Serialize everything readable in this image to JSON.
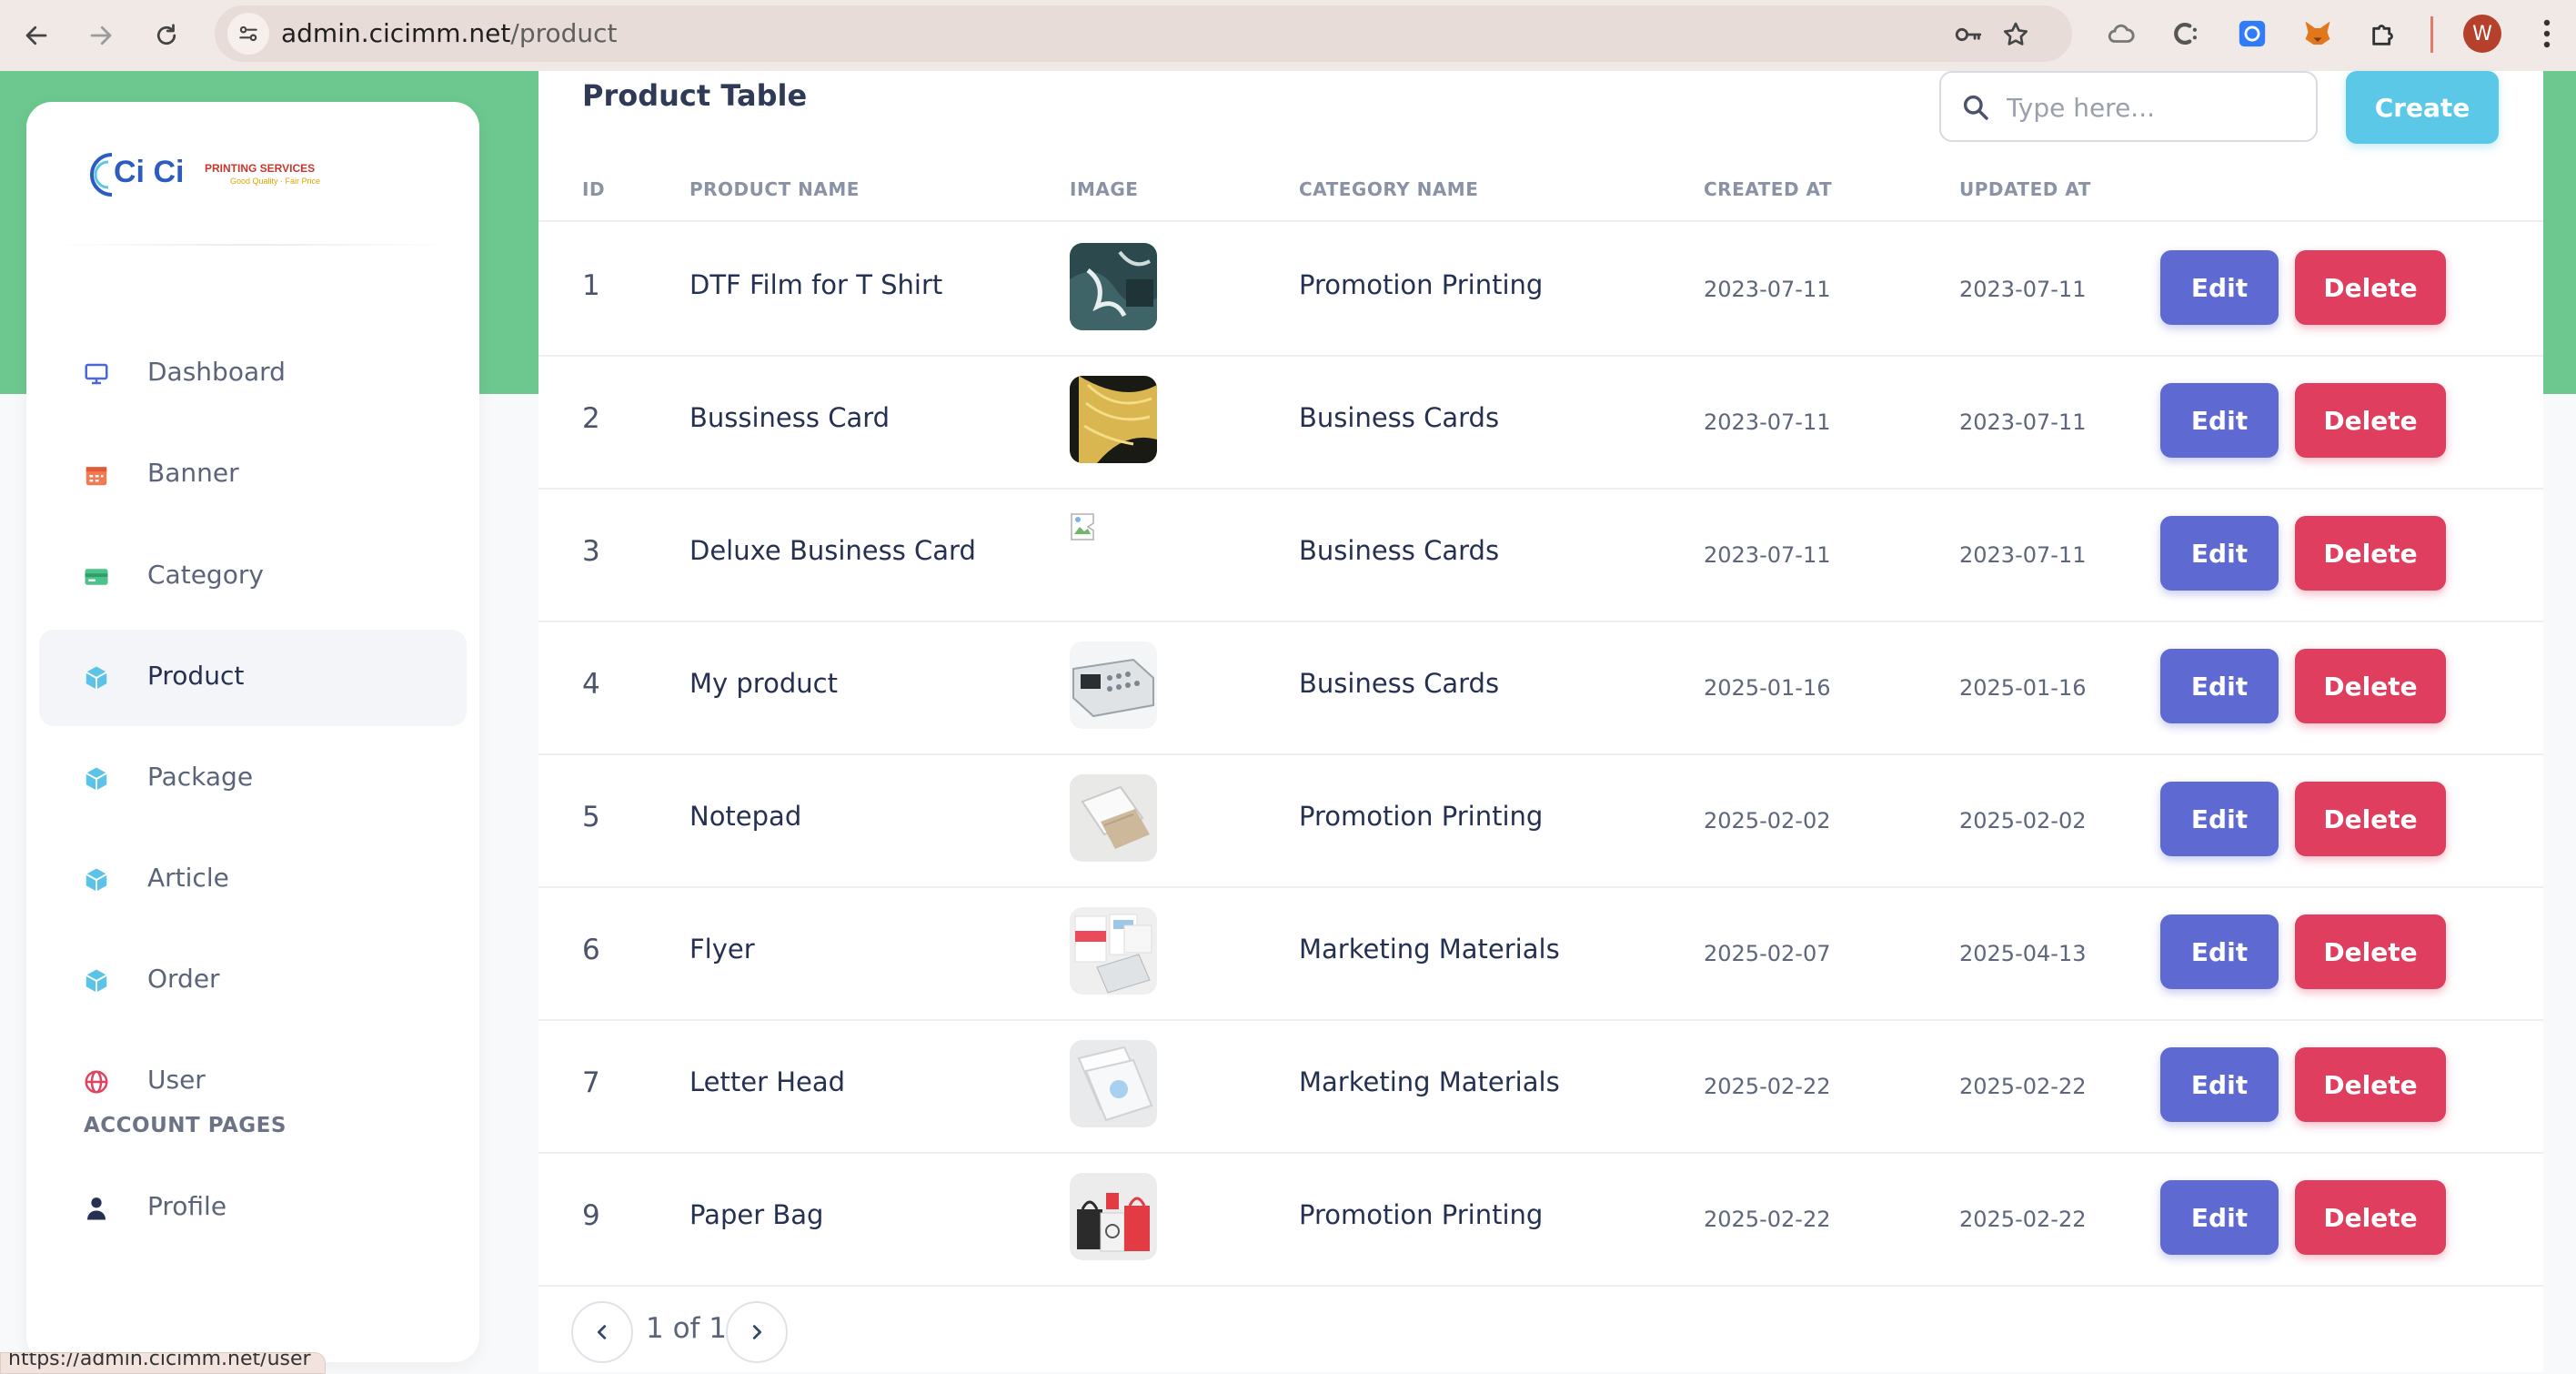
{
  "browser": {
    "url_host": "admin.cicimm.net",
    "url_path": "/product",
    "profile_initial": "W",
    "status_url": "https://admin.cicimm.net/user"
  },
  "logo": {
    "main": "Ci Ci",
    "sub": "PRINTING SERVICES",
    "tagline": "Good Quality · Fair Price"
  },
  "sidebar": {
    "items": [
      {
        "label": "Dashboard",
        "icon": "monitor-icon"
      },
      {
        "label": "Banner",
        "icon": "calendar-icon"
      },
      {
        "label": "Category",
        "icon": "credit-card-icon"
      },
      {
        "label": "Product",
        "icon": "box-icon"
      },
      {
        "label": "Package",
        "icon": "box-icon"
      },
      {
        "label": "Article",
        "icon": "box-icon"
      },
      {
        "label": "Order",
        "icon": "box-icon"
      },
      {
        "label": "User",
        "icon": "globe-icon"
      }
    ],
    "section_title": "ACCOUNT PAGES",
    "profile_label": "Profile"
  },
  "main": {
    "title": "Product Table",
    "search_placeholder": "Type here...",
    "create_label": "Create",
    "columns": [
      "ID",
      "PRODUCT NAME",
      "IMAGE",
      "CATEGORY NAME",
      "CREATED AT",
      "UPDATED AT"
    ],
    "edit_label": "Edit",
    "delete_label": "Delete",
    "rows": [
      {
        "id": "1",
        "name": "DTF Film for T Shirt",
        "category": "Promotion Printing",
        "created": "2023-07-11",
        "updated": "2023-07-11"
      },
      {
        "id": "2",
        "name": "Bussiness Card",
        "category": "Business Cards",
        "created": "2023-07-11",
        "updated": "2023-07-11"
      },
      {
        "id": "3",
        "name": "Deluxe Business Card",
        "category": "Business Cards",
        "created": "2023-07-11",
        "updated": "2023-07-11"
      },
      {
        "id": "4",
        "name": "My product",
        "category": "Business Cards",
        "created": "2025-01-16",
        "updated": "2025-01-16"
      },
      {
        "id": "5",
        "name": "Notepad",
        "category": "Promotion Printing",
        "created": "2025-02-02",
        "updated": "2025-02-02"
      },
      {
        "id": "6",
        "name": "Flyer",
        "category": "Marketing Materials",
        "created": "2025-02-07",
        "updated": "2025-04-13"
      },
      {
        "id": "7",
        "name": "Letter Head",
        "category": "Marketing Materials",
        "created": "2025-02-22",
        "updated": "2025-02-22"
      },
      {
        "id": "9",
        "name": "Paper Bag",
        "category": "Promotion Printing",
        "created": "2025-02-22",
        "updated": "2025-02-22"
      }
    ],
    "pagination": "1 of 1"
  },
  "colors": {
    "header_band": "#6cc88e",
    "create_button": "#5ac8e6",
    "edit_button": "#5e6ad2",
    "delete_button": "#df3e5e"
  }
}
